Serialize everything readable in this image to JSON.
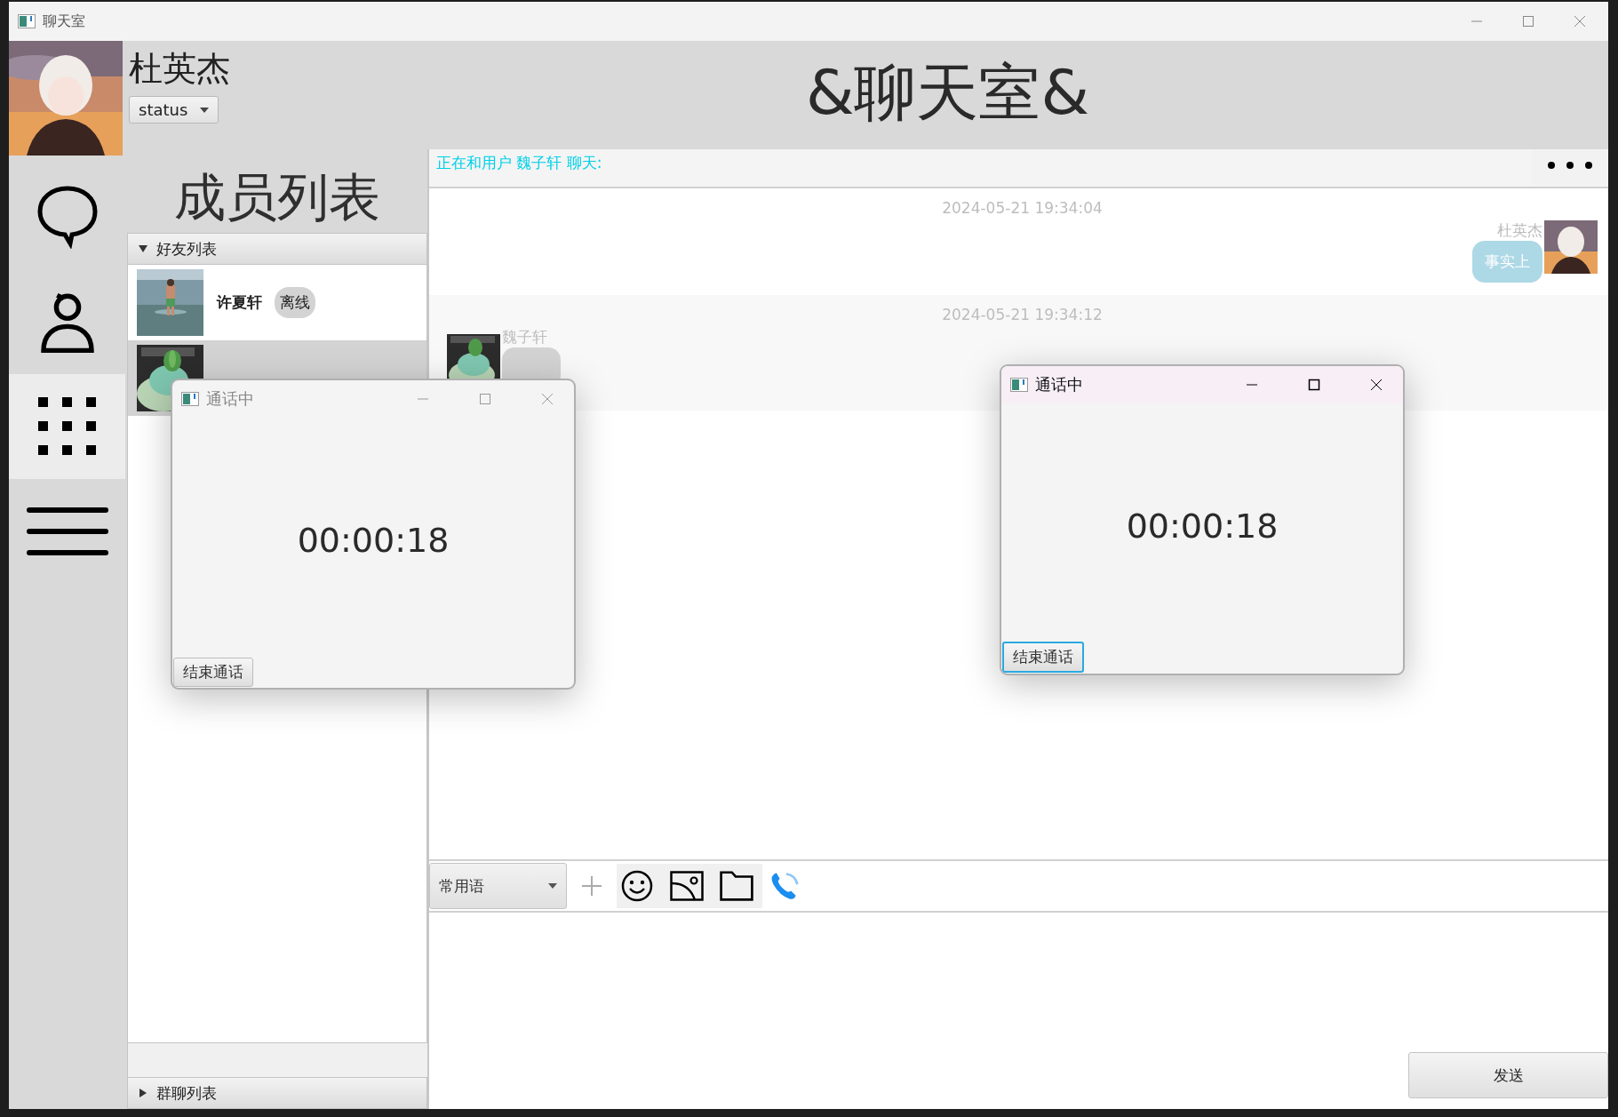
{
  "window": {
    "title": "聊天室"
  },
  "user": {
    "name": "杜英杰",
    "status_dropdown": "status"
  },
  "app_title": "&聊天室&",
  "nav": [
    {
      "kind": "chat",
      "selected": false
    },
    {
      "kind": "contacts",
      "selected": false
    },
    {
      "kind": "apps",
      "selected": true
    },
    {
      "kind": "menu",
      "selected": false
    }
  ],
  "members": {
    "heading": "成员列表",
    "sections": [
      {
        "title": "好友列表",
        "expanded": true,
        "members": [
          {
            "name": "许夏轩",
            "status": "离线",
            "online": false,
            "selected": false
          },
          {
            "selected": true
          }
        ]
      },
      {
        "title": "群聊列表",
        "expanded": false
      }
    ]
  },
  "chat": {
    "header": "正在和用户 魏子轩 聊天:",
    "messages": [
      {
        "time": "2024-05-21 19:34:04",
        "sender": "杜英杰",
        "text": "事实上",
        "outgoing": true
      },
      {
        "time": "2024-05-21 19:34:12",
        "sender": "魏子轩",
        "outgoing": false
      }
    ]
  },
  "toolbar": {
    "phrases_dropdown": "常用语"
  },
  "send_button": "发送",
  "call_windows": [
    {
      "title": "通话中",
      "timer": "00:00:18",
      "end_button": "结束通话",
      "focused": false
    },
    {
      "title": "通话中",
      "timer": "00:00:18",
      "end_button": "结束通话",
      "focused": true
    }
  ]
}
